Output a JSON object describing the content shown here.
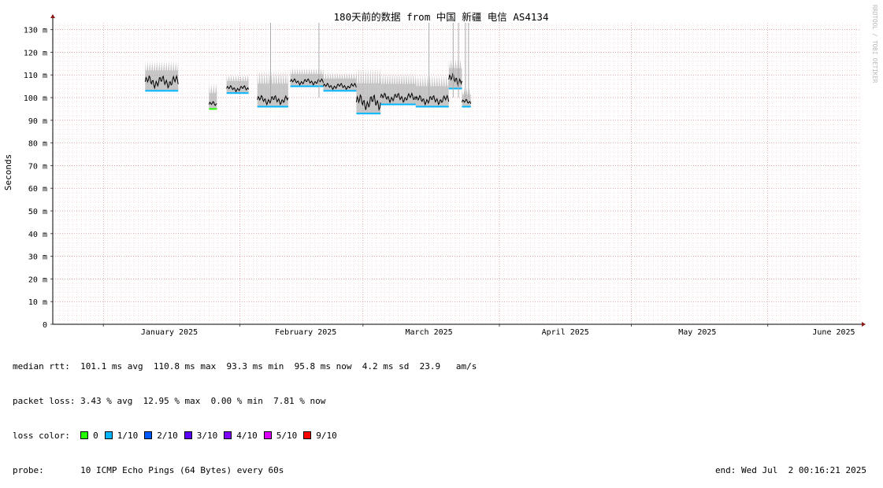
{
  "chart_data": {
    "type": "area",
    "title": "180天前的数据 from 中国 新疆 电信 AS4134",
    "ylabel": "Seconds",
    "watermark": "RRDTOOL / TOBI OETIKER",
    "y_ticks": [
      "0",
      "10 m",
      "20 m",
      "30 m",
      "40 m",
      "50 m",
      "60 m",
      "70 m",
      "80 m",
      "90 m",
      "100 m",
      "110 m",
      "120 m",
      "130 m"
    ],
    "ylim": [
      0,
      133
    ],
    "x_tick_labels": [
      "January 2025",
      "February 2025",
      "March 2025",
      "April 2025",
      "May 2025",
      "June 2025"
    ],
    "x_range_days": [
      -11.5,
      172
    ],
    "x_tick_days": [
      15,
      46,
      74,
      105,
      135,
      166
    ],
    "month_start_days": [
      0,
      31,
      59,
      90,
      120,
      151
    ],
    "grid": true,
    "median_color": "#000000",
    "smoke_color": "#999999",
    "segments": [
      {
        "start_day": 9.5,
        "end_day": 17.0,
        "median_ms": 107,
        "min_ms": 103,
        "max_ms": 116,
        "loss_color": "#00b7ff"
      },
      {
        "start_day": 24.0,
        "end_day": 25.8,
        "median_ms": 97,
        "min_ms": 95,
        "max_ms": 106,
        "loss_color": "#26ff00"
      },
      {
        "start_day": 28.0,
        "end_day": 33.0,
        "median_ms": 104,
        "min_ms": 102,
        "max_ms": 110,
        "loss_color": "#00b7ff"
      },
      {
        "start_day": 35.0,
        "end_day": 42.0,
        "median_ms": 99,
        "min_ms": 96,
        "max_ms": 112,
        "loss_color": "#00b7ff"
      },
      {
        "start_day": 42.5,
        "end_day": 50.0,
        "median_ms": 107,
        "min_ms": 105,
        "max_ms": 113,
        "loss_color": "#00b7ff"
      },
      {
        "start_day": 50.0,
        "end_day": 57.5,
        "median_ms": 105,
        "min_ms": 103,
        "max_ms": 111,
        "loss_color": "#00b7ff"
      },
      {
        "start_day": 57.5,
        "end_day": 63.0,
        "median_ms": 98,
        "min_ms": 93,
        "max_ms": 113,
        "loss_color": "#00b7ff"
      },
      {
        "start_day": 63.0,
        "end_day": 71.0,
        "median_ms": 100,
        "min_ms": 97,
        "max_ms": 111,
        "loss_color": "#00b7ff"
      },
      {
        "start_day": 71.0,
        "end_day": 78.5,
        "median_ms": 99,
        "min_ms": 96,
        "max_ms": 110,
        "loss_color": "#00b7ff"
      },
      {
        "start_day": 78.5,
        "end_day": 81.5,
        "median_ms": 108,
        "min_ms": 104,
        "max_ms": 117,
        "loss_color": "#00b7ff"
      },
      {
        "start_day": 81.5,
        "end_day": 83.5,
        "median_ms": 98,
        "min_ms": 96,
        "max_ms": 104,
        "loss_color": "#00b7ff"
      }
    ],
    "spikes": [
      {
        "day": 38.0,
        "ms": 133
      },
      {
        "day": 49.0,
        "ms": 133
      },
      {
        "day": 74.0,
        "ms": 133
      },
      {
        "day": 79.5,
        "ms": 133
      },
      {
        "day": 80.7,
        "ms": 133
      },
      {
        "day": 82.3,
        "ms": 133
      },
      {
        "day": 83.0,
        "ms": 133
      }
    ]
  },
  "stats": {
    "median_label": "median rtt:",
    "median_values": "101.1 ms avg  110.8 ms max  93.3 ms min  95.8 ms now  4.2 ms sd  23.9   am/s",
    "loss_label": "packet loss:",
    "loss_values": "3.43 % avg  12.95 % max  0.00 % min  7.81 % now",
    "loss_color_label": "loss color:",
    "loss_colors": [
      {
        "label": "0",
        "color": "#26ff00"
      },
      {
        "label": "1/10",
        "color": "#00b7ff"
      },
      {
        "label": "2/10",
        "color": "#0059ff"
      },
      {
        "label": "3/10",
        "color": "#5e00ff"
      },
      {
        "label": "4/10",
        "color": "#7e00ff"
      },
      {
        "label": "5/10",
        "color": "#dd00ff"
      },
      {
        "label": "9/10",
        "color": "#ff0000"
      }
    ],
    "probe_label": "probe:",
    "probe_value": "10 ICMP Echo Pings (64 Bytes) every 60s",
    "end_text": "end: Wed Jul  2 00:16:21 2025"
  }
}
